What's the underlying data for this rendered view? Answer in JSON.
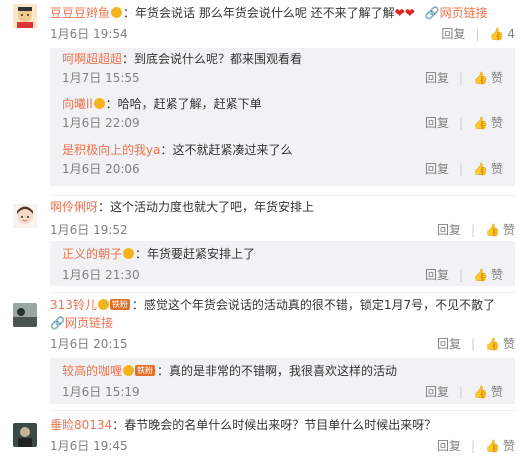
{
  "icons": {
    "link": "🔗",
    "thumb": "👍",
    "heart": "❤"
  },
  "labels": {
    "reply": "回复",
    "like": "赞"
  },
  "comments": [
    {
      "name": "豆豆豆辫鱼",
      "text": "：年货会说话 那么年货会说什么呢 还不来了解了解",
      "link": "网页链接",
      "time": "1月6日 19:54",
      "likes": "4",
      "replies": [
        {
          "name": "呵啊超超超",
          "text": "：到底会说什么呢？都来围观看看",
          "time": "1月7日 15:55"
        },
        {
          "name": "向曦ll",
          "text": "：哈哈，赶紧了解，赶紧下单",
          "time": "1月6日 22:09"
        },
        {
          "name": "是积极向上的我ya",
          "text": "：这不就赶紧凑过来了么",
          "time": "1月6日 20:06"
        }
      ]
    },
    {
      "name": "啊伶俐呀",
      "text": "：这个活动力度也就大了吧，年货安排上",
      "time": "1月6日 19:52",
      "replies": [
        {
          "name": "正义的朝子",
          "text": "：年货要赶紧安排上了",
          "time": "1月6日 21:30"
        }
      ]
    },
    {
      "name": "313铃儿",
      "text": "：感觉这个年货会说话的活动真的很不错，锁定1月7号，不见不散了",
      "link": "网页链接",
      "tag": "铁粉",
      "time": "1月6日 20:15",
      "replies": [
        {
          "name": "较高的咖喱",
          "tag": "铁粉",
          "text": "：真的是非常的不错啊，我很喜欢这样的活动",
          "time": "1月6日 15:19"
        }
      ]
    },
    {
      "name": "垂睑80134",
      "text": "：春节晚会的名单什么时候出来呀？节目单什么时候出来呀？",
      "time": "1月6日 19:45"
    }
  ]
}
